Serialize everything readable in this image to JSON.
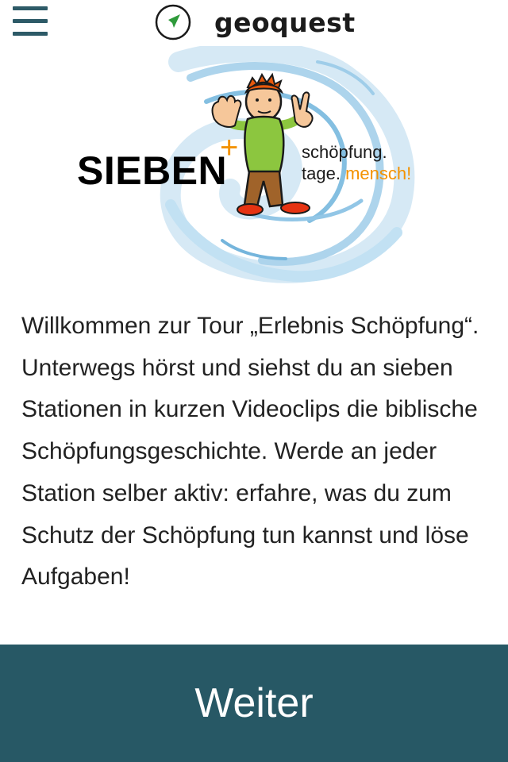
{
  "header": {
    "menu_icon": "hamburger-menu-icon",
    "logo_icon": "navigation-arrow-icon",
    "app_name": "geoquest"
  },
  "hero": {
    "wordmark": "SIEBEN",
    "plus": "+",
    "tagline_line1": "schöpfung.",
    "tagline_line2_prefix": "tage.",
    "tagline_line2_accent": "mensch!",
    "colors": {
      "accent_orange": "#f39200",
      "water_blue": "#6fb4dc",
      "shirt_green": "#8cc63f",
      "trousers_brown": "#a0632a"
    }
  },
  "intro": {
    "text": "Willkommen zur Tour „Erlebnis Schöpfung“. Unterwegs hörst und siehst du an sieben Stationen in kurzen Videoclips die biblische Schöpfungsgeschichte. Werde an jeder Station selber aktiv: erfahre, was du zum Schutz der Schöpfung tun kannst und löse Aufgaben!"
  },
  "footer": {
    "next_label": "Weiter",
    "button_color": "#275865"
  }
}
